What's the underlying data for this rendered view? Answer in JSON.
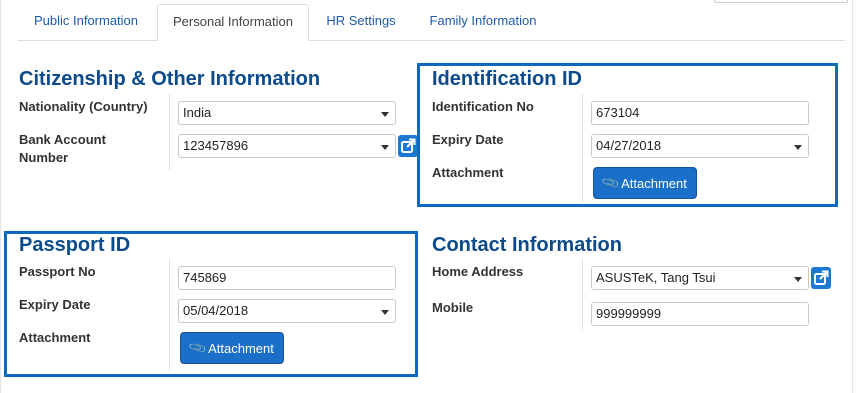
{
  "tabs": [
    {
      "label": "Public Information"
    },
    {
      "label": "Personal Information"
    },
    {
      "label": "HR Settings"
    },
    {
      "label": "Family Information"
    }
  ],
  "citizenship": {
    "title": "Citizenship & Other Information",
    "nationality_label": "Nationality (Country)",
    "nationality_value": "India",
    "bank_label_1": "Bank Account",
    "bank_label_2": "Number",
    "bank_value": "123457896"
  },
  "identification": {
    "title": "Identification ID",
    "number_label": "Identification No",
    "number_value": "673104",
    "expiry_label": "Expiry Date",
    "expiry_value": "04/27/2018",
    "attachment_label": "Attachment",
    "attachment_button": "Attachment"
  },
  "passport": {
    "title": "Passport ID",
    "number_label": "Passport No",
    "number_value": "745869",
    "expiry_label": "Expiry Date",
    "expiry_value": "05/04/2018",
    "attachment_label": "Attachment",
    "attachment_button": "Attachment"
  },
  "contact": {
    "title": "Contact Information",
    "address_label": "Home Address",
    "address_value": "ASUSTeK, Tang Tsui",
    "mobile_label": "Mobile",
    "mobile_value": "999999999"
  },
  "colors": {
    "accent": "#0d6abf",
    "title": "#0b4b8c",
    "button": "#1a6fc9",
    "tab_link": "#1f5aa8"
  },
  "icons": {
    "external_link": "external-link-icon",
    "paperclip": "paperclip-icon",
    "dropdown": "caret-down-icon"
  }
}
